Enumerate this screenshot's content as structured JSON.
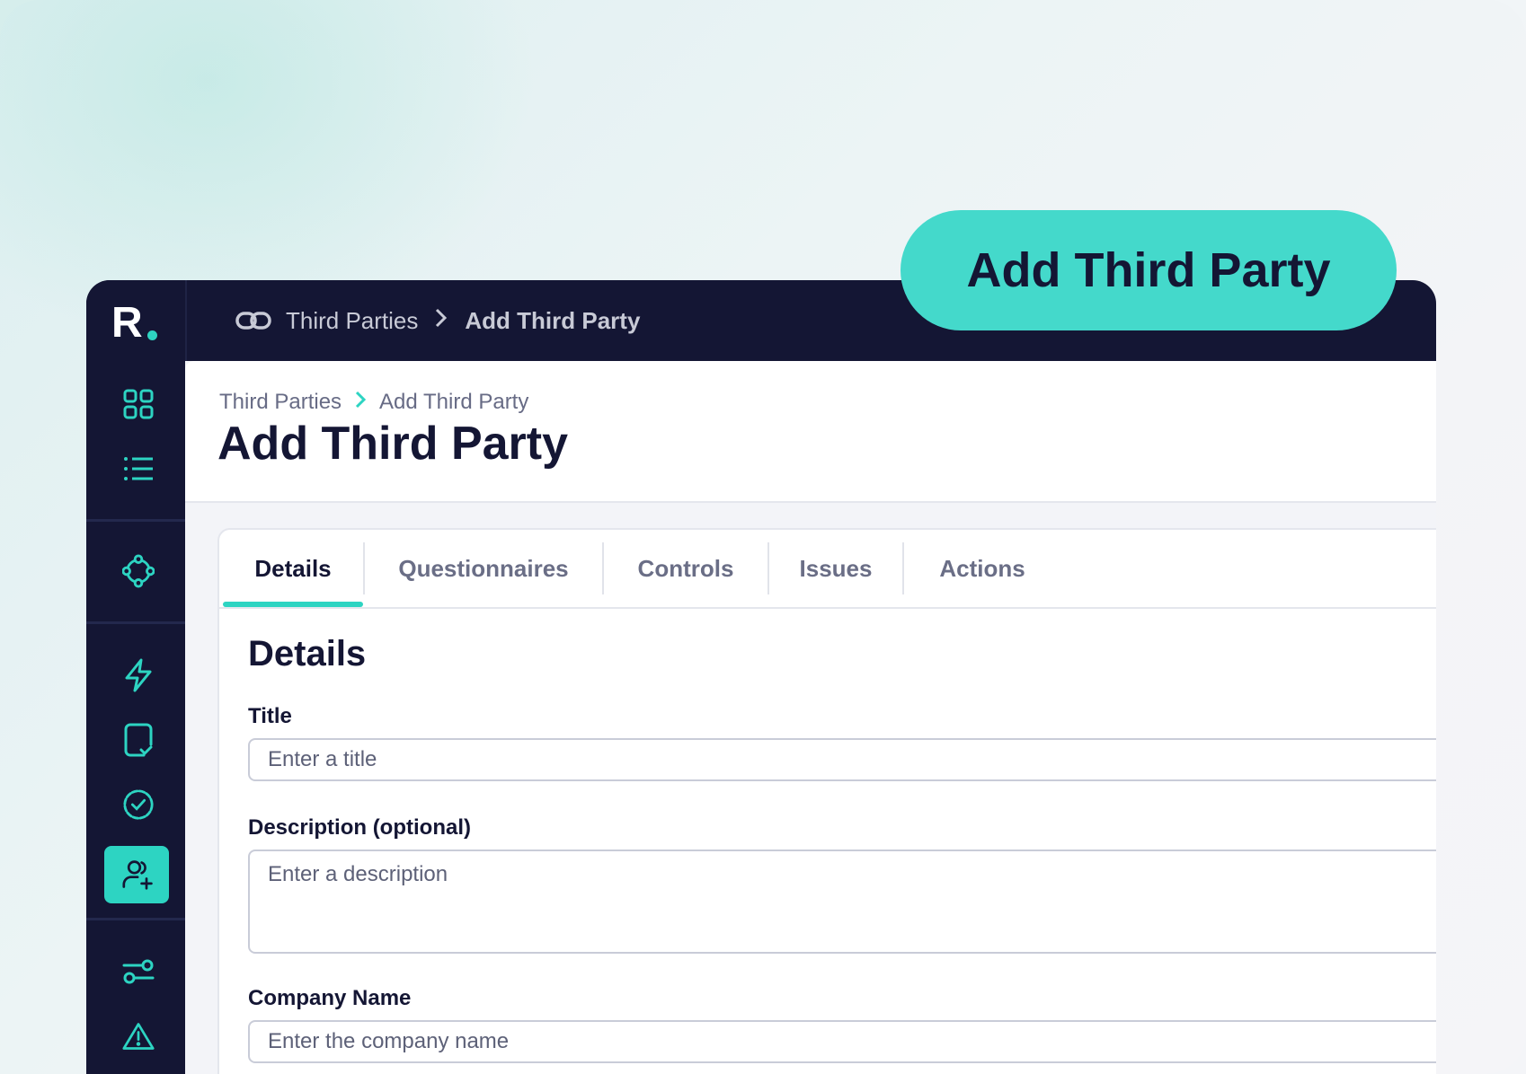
{
  "callout": {
    "label": "Add Third Party"
  },
  "topbar": {
    "logo_text": "R",
    "breadcrumb": {
      "parent": "Third Parties",
      "separator": ">",
      "current": "Add Third Party"
    },
    "icon": "link-icon"
  },
  "sidebar": {
    "items": [
      {
        "icon": "dashboard-grid-icon",
        "active": false
      },
      {
        "icon": "list-icon",
        "active": false
      },
      {
        "icon": "network-nodes-icon",
        "active": false
      },
      {
        "icon": "lightning-icon",
        "active": false
      },
      {
        "icon": "document-check-icon",
        "active": false
      },
      {
        "icon": "badge-check-icon",
        "active": false
      },
      {
        "icon": "add-user-icon",
        "active": true
      },
      {
        "icon": "sliders-icon",
        "active": false
      },
      {
        "icon": "warning-icon",
        "active": false
      }
    ]
  },
  "page": {
    "breadcrumb": {
      "parent": "Third Parties",
      "current": "Add Third Party"
    },
    "title": "Add Third Party"
  },
  "tabs": [
    {
      "label": "Details",
      "active": true
    },
    {
      "label": "Questionnaires",
      "active": false
    },
    {
      "label": "Controls",
      "active": false
    },
    {
      "label": "Issues",
      "active": false
    },
    {
      "label": "Actions",
      "active": false
    }
  ],
  "form": {
    "section_title": "Details",
    "title_label": "Title",
    "title_placeholder": "Enter a title",
    "description_label": "Description (optional)",
    "description_placeholder": "Enter a description",
    "company_label": "Company Name",
    "company_placeholder": "Enter the company name"
  },
  "colors": {
    "accent": "#2dd4c2",
    "navy": "#141634",
    "callout_bg": "#44d9cb"
  }
}
